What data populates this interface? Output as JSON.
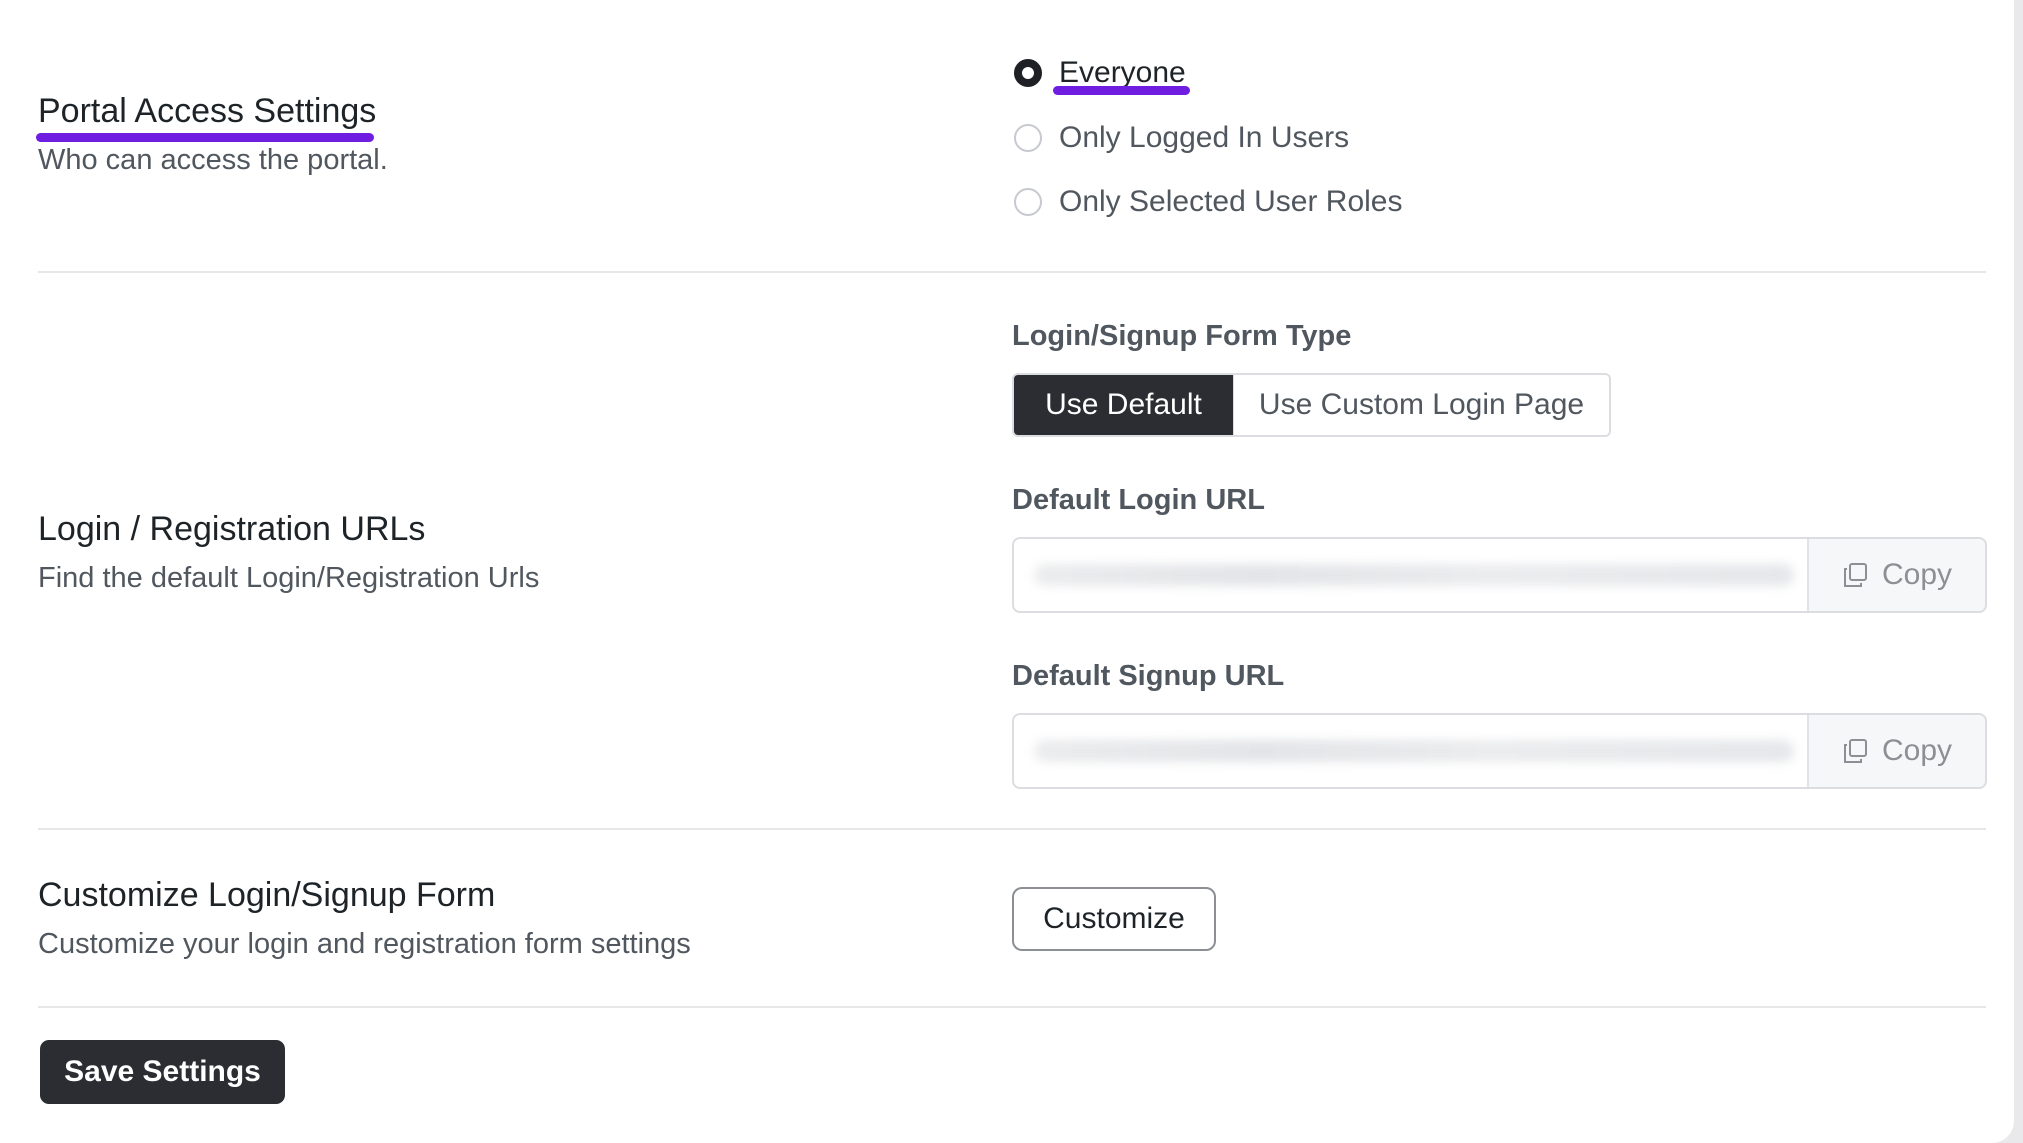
{
  "portal_access": {
    "title": "Portal Access Settings",
    "description": "Who can access the portal.",
    "options": [
      {
        "label": "Everyone",
        "selected": true
      },
      {
        "label": "Only Logged In Users",
        "selected": false
      },
      {
        "label": "Only Selected User Roles",
        "selected": false
      }
    ]
  },
  "login_urls": {
    "title": "Login / Registration URLs",
    "description": "Find the default Login/Registration Urls",
    "form_type_label": "Login/Signup Form Type",
    "form_type_options": [
      "Use Default",
      "Use Custom Login Page"
    ],
    "form_type_selected": "Use Default",
    "login_url_label": "Default Login URL",
    "signup_url_label": "Default Signup URL",
    "copy_label": "Copy",
    "copy_icon": "copy-icon"
  },
  "customize_form": {
    "title": "Customize Login/Signup Form",
    "description": "Customize your login and registration form settings",
    "button_label": "Customize"
  },
  "footer": {
    "save_label": "Save Settings"
  },
  "colors": {
    "accent_underline": "#6f1de0",
    "primary_button": "#2b2d33",
    "text_primary": "#1d2327",
    "text_secondary": "#50575e"
  }
}
